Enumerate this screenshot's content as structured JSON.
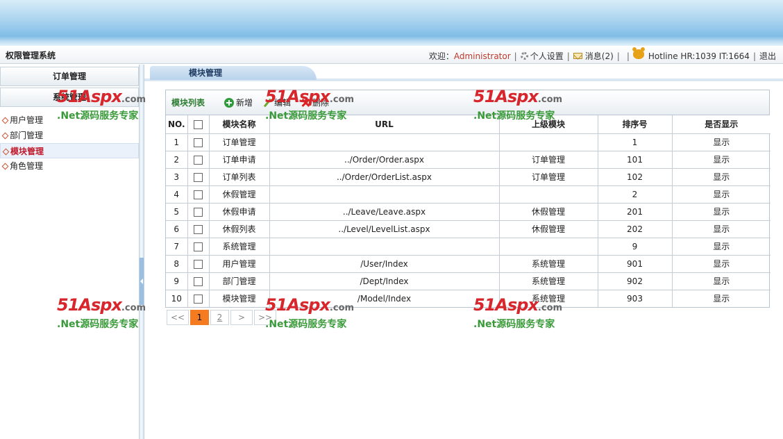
{
  "header": {
    "system_title": "权限管理系统",
    "welcome_label": "欢迎：",
    "username": "Administrator",
    "settings_label": "个人设置",
    "messages_label": "消息(2)",
    "hotline": "Hotline HR:1039 IT:1664",
    "logout_label": "退出"
  },
  "sidebar": {
    "groups": [
      "订单管理",
      "系统管理"
    ],
    "items": [
      {
        "label": "用户管理"
      },
      {
        "label": "部门管理"
      },
      {
        "label": "模块管理"
      },
      {
        "label": "角色管理"
      }
    ],
    "active_item": "模块管理"
  },
  "tab": {
    "label": "模块管理"
  },
  "toolbar": {
    "title": "模块列表",
    "add_label": "新增",
    "edit_label": "编辑",
    "delete_label": "删除"
  },
  "table": {
    "headers": {
      "no": "NO.",
      "name": "模块名称",
      "url": "URL",
      "parent": "上级模块",
      "order": "排序号",
      "visible": "是否显示"
    },
    "rows": [
      {
        "no": "1",
        "name": "订单管理",
        "url": "",
        "parent": "",
        "order": "1",
        "visible": "显示"
      },
      {
        "no": "2",
        "name": "订单申请",
        "url": "../Order/Order.aspx",
        "parent": "订单管理",
        "order": "101",
        "visible": "显示"
      },
      {
        "no": "3",
        "name": "订单列表",
        "url": "../Order/OrderList.aspx",
        "parent": "订单管理",
        "order": "102",
        "visible": "显示"
      },
      {
        "no": "4",
        "name": "休假管理",
        "url": "",
        "parent": "",
        "order": "2",
        "visible": "显示"
      },
      {
        "no": "5",
        "name": "休假申请",
        "url": "../Leave/Leave.aspx",
        "parent": "休假管理",
        "order": "201",
        "visible": "显示"
      },
      {
        "no": "6",
        "name": "休假列表",
        "url": "../Level/LevelList.aspx",
        "parent": "休假管理",
        "order": "202",
        "visible": "显示"
      },
      {
        "no": "7",
        "name": "系统管理",
        "url": "",
        "parent": "",
        "order": "9",
        "visible": "显示"
      },
      {
        "no": "8",
        "name": "用户管理",
        "url": "/User/Index",
        "parent": "系统管理",
        "order": "901",
        "visible": "显示"
      },
      {
        "no": "9",
        "name": "部门管理",
        "url": "/Dept/Index",
        "parent": "系统管理",
        "order": "902",
        "visible": "显示"
      },
      {
        "no": "10",
        "name": "模块管理",
        "url": "/Model/Index",
        "parent": "系统管理",
        "order": "903",
        "visible": "显示"
      }
    ]
  },
  "pager": {
    "first": "<<",
    "pages": [
      "1",
      "2"
    ],
    "current": "1",
    "next": ">",
    "last": ">>"
  },
  "watermark": {
    "brand": "51Aspx",
    "domain": ".com",
    "slogan": ".Net源码服务专家"
  },
  "colors": {
    "accent_red": "#c0392b",
    "toolbar_title_green": "#2e7d32",
    "pager_current": "#f47b20"
  }
}
